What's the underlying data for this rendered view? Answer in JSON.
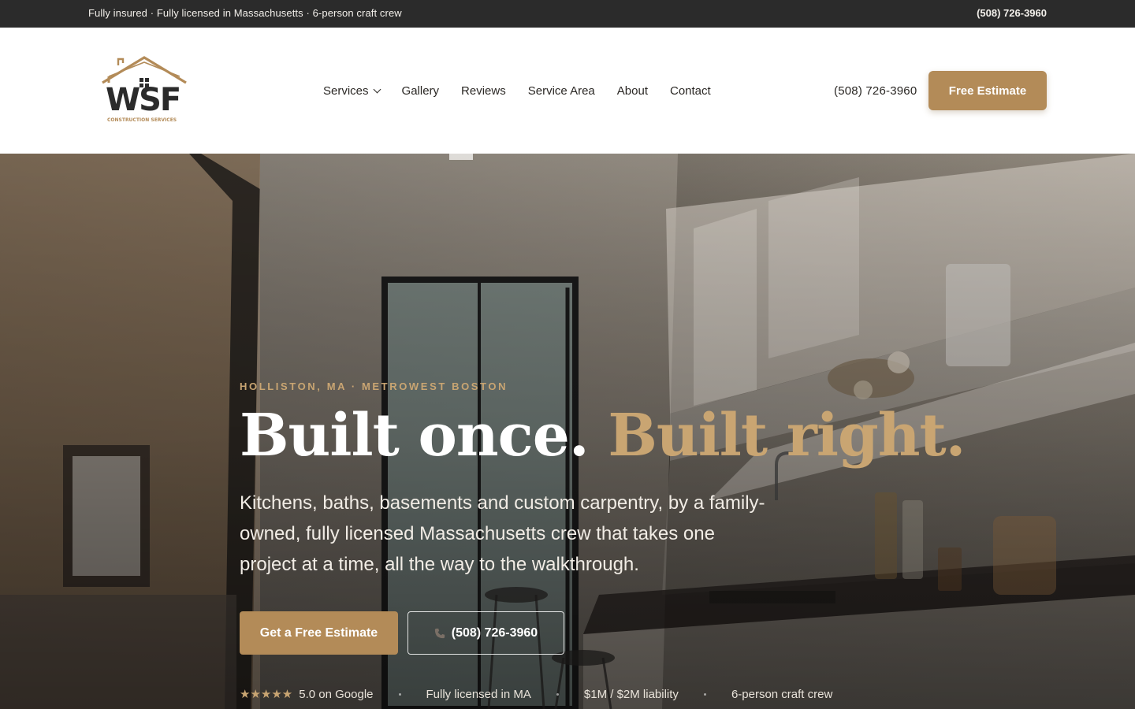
{
  "topbar": {
    "tagline": "Fully insured · Fully licensed in Massachusetts · 6-person craft crew",
    "phone": "(508) 726-3960"
  },
  "header": {
    "logo": {
      "text": "WSF",
      "subtext": "CONSTRUCTION SERVICES"
    },
    "nav": [
      {
        "label": "Services",
        "has_dropdown": true
      },
      {
        "label": "Gallery"
      },
      {
        "label": "Reviews"
      },
      {
        "label": "Service Area"
      },
      {
        "label": "About"
      },
      {
        "label": "Contact"
      }
    ],
    "phone": "(508) 726-3960",
    "cta_label": "Free Estimate"
  },
  "hero": {
    "eyebrow": "HOLLISTON, MA · METROWEST BOSTON",
    "headline_main": "Built once.",
    "headline_accent": "Built right.",
    "lede": "Kitchens, baths, basements and custom carpentry, by a family-owned, fully licensed Massachusetts crew that takes one project at a time, all the way to the walkthrough.",
    "cta_primary": "Get a Free Estimate",
    "cta_secondary": "(508) 726-3960",
    "trust": {
      "stars": "★★★★★",
      "rating": "5.0 on Google",
      "licensed": "Fully licensed in MA",
      "liability": "$1M / $2M liability",
      "crew": "6-person craft crew"
    }
  },
  "colors": {
    "accent": "#b38b58",
    "accent_light": "#c9a572",
    "topbar_bg": "#2b2b2b",
    "text_dark": "#2a2724"
  }
}
